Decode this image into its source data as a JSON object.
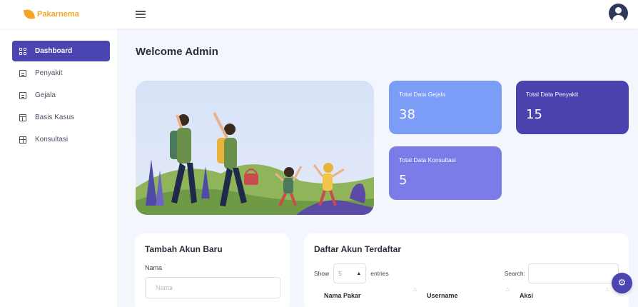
{
  "app": {
    "brand_name": "Pakarnema",
    "brand_color": "#f5a623",
    "accent_color": "#4a45b0"
  },
  "topbar": {
    "menu_icon": "hamburger-icon",
    "avatar_icon": "user-avatar-icon"
  },
  "sidebar": {
    "items": [
      {
        "label": "Dashboard",
        "icon": "grid-icon",
        "active": true
      },
      {
        "label": "Penyakit",
        "icon": "document-icon"
      },
      {
        "label": "Gejala",
        "icon": "document-icon"
      },
      {
        "label": "Basis Kasus",
        "icon": "layout-icon"
      },
      {
        "label": "Konsultasi",
        "icon": "table-icon"
      }
    ]
  },
  "main": {
    "title": "Welcome Admin",
    "stats": [
      {
        "label": "Total Data Gejala",
        "value": "38",
        "color": "#7b9cf7"
      },
      {
        "label": "Total Data Penyakit",
        "value": "15",
        "color": "#4a43ad"
      },
      {
        "label": "Total Data Konsultasi",
        "value": "5",
        "color": "#7b7ce8"
      }
    ],
    "form": {
      "title": "Tambah Akun Baru",
      "nama_label": "Nama",
      "nama_placeholder": "Nama"
    },
    "table": {
      "title": "Daftar Akun Terdaftar",
      "show_label": "Show",
      "entries_value": "5",
      "entries_label": "entries",
      "search_label": "Search:",
      "columns": [
        "Nama Pakar",
        "Username",
        "Aksi"
      ]
    }
  },
  "fab": {
    "icon": "gear-icon"
  }
}
